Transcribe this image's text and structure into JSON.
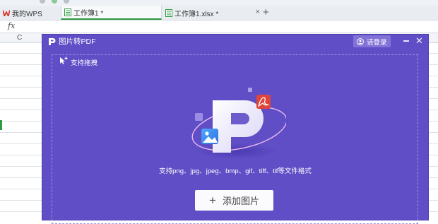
{
  "tabs": [
    {
      "label": "我的WPS",
      "icon": "wps-logo-icon"
    },
    {
      "label": "工作簿1 *",
      "icon": "spreadsheet-icon"
    },
    {
      "label": "工作簿1.xlsx *",
      "icon": "spreadsheet-icon"
    }
  ],
  "formula_bar": {
    "fx_label": "fx"
  },
  "column_header": "C",
  "dialog": {
    "title": "图片转PDF",
    "login_label": "请登录",
    "drag_hint": "支持拖拽",
    "supported_formats": "支持png、jpg、jpeg、bmp、gif、tiff、tif等文件格式",
    "add_button_label": "添加图片"
  },
  "colors": {
    "dialog_background": "#5f4ec6",
    "accent_red": "#e0453a",
    "active_tab_underline": "#2e9b3e"
  }
}
